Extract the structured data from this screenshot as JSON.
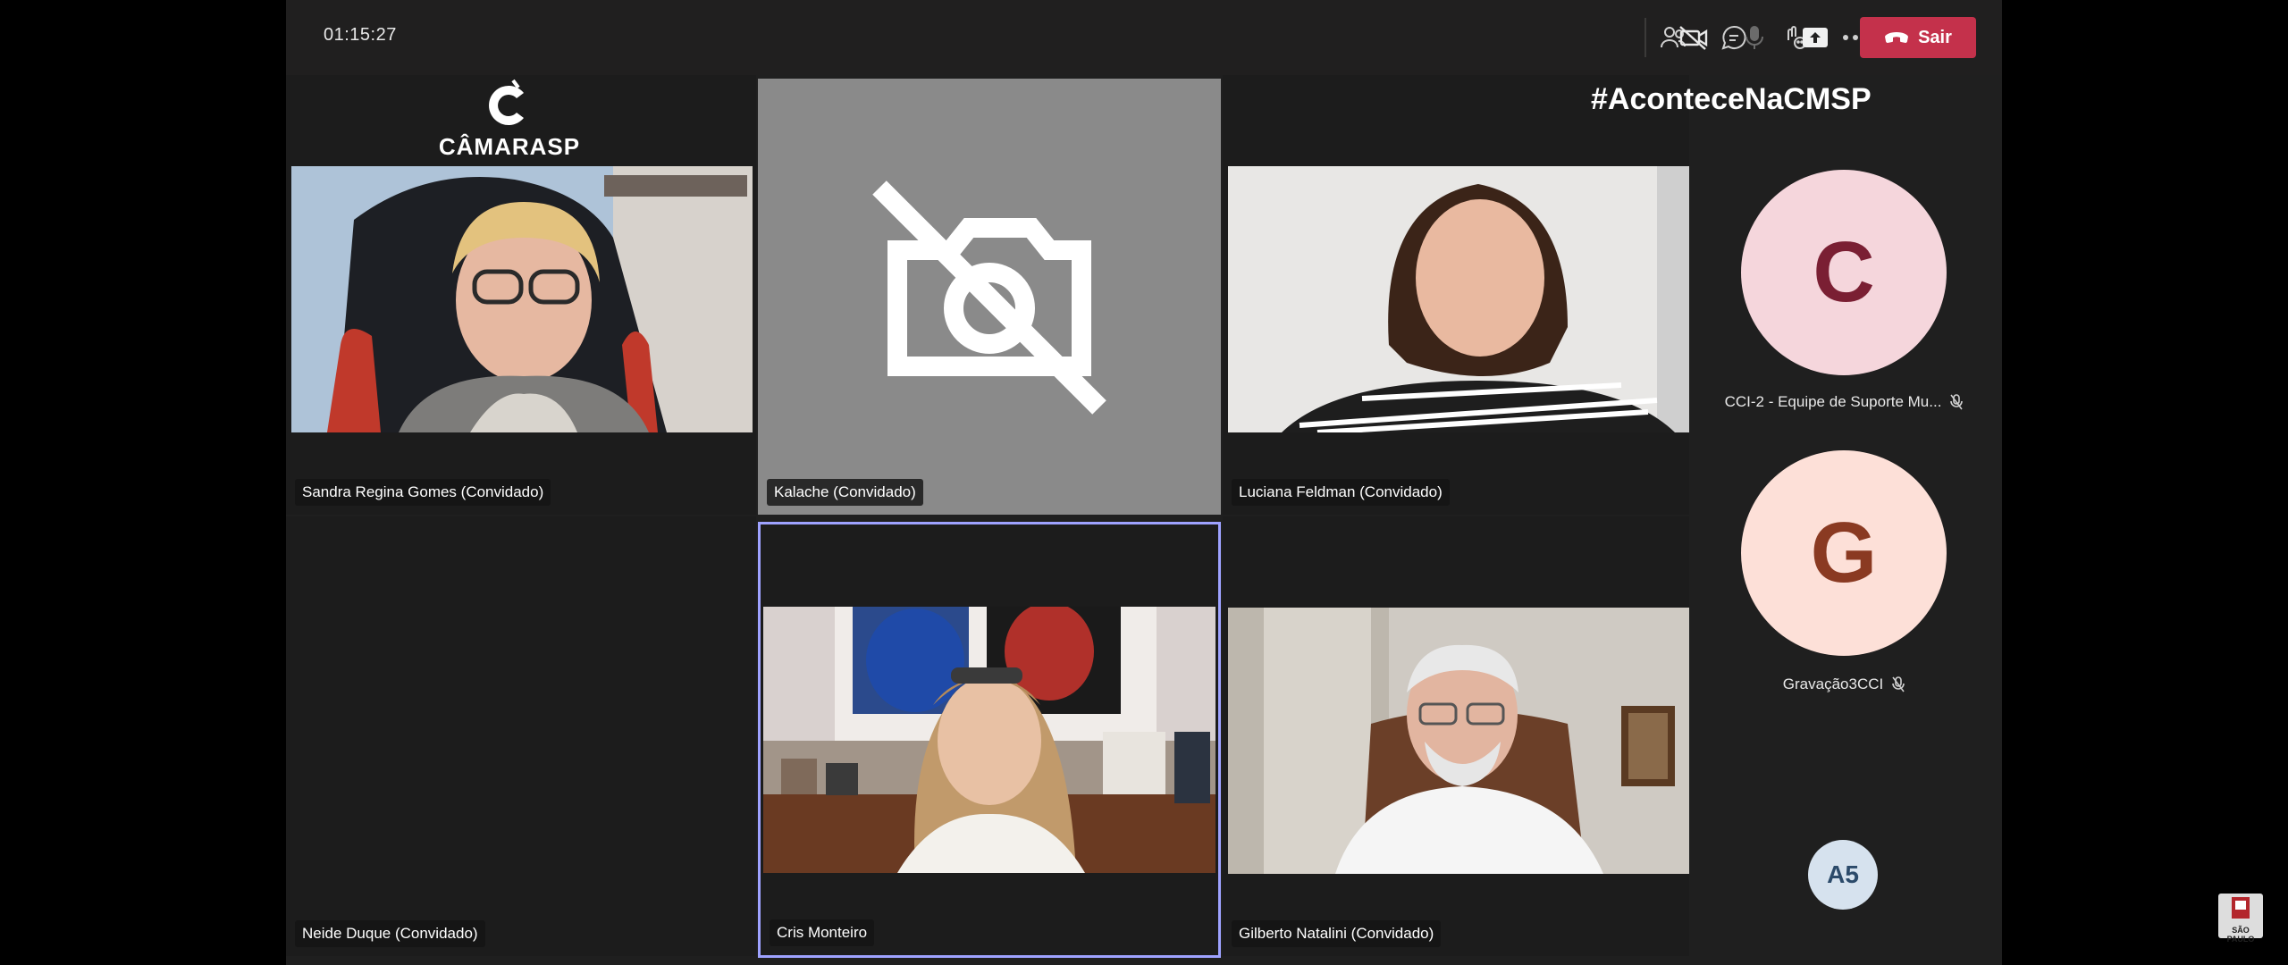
{
  "meeting": {
    "timer": "01:15:27",
    "leave_label": "Sair"
  },
  "toolbar": {
    "icons": [
      "people-icon",
      "chat-icon",
      "reactions-icon",
      "more-icon",
      "camera-off-icon",
      "mic-icon",
      "share-icon",
      "phone-hangup-icon"
    ]
  },
  "branding": {
    "logo_text": "CÂMARASP",
    "hashtag": "#AconteceNaCMSP"
  },
  "participants": [
    {
      "name": "Sandra Regina Gomes (Convidado)"
    },
    {
      "name": "Kalache (Convidado)"
    },
    {
      "name": "Luciana Feldman (Convidado)"
    },
    {
      "name": "Neide Duque (Convidado)"
    },
    {
      "name": "Cris Monteiro"
    },
    {
      "name": "Gilberto Natalini (Convidado)"
    }
  ],
  "sidebar": {
    "items": [
      {
        "initial": "C",
        "name": "CCI-2 - Equipe de Suporte Mu...",
        "color": "#f5d6dc",
        "text_color": "#7a1f33"
      },
      {
        "initial": "G",
        "name": "Gravação3CCI",
        "color": "#fde0d8",
        "text_color": "#8a3a22"
      }
    ],
    "overflow": "A5"
  },
  "colors": {
    "accent": "#9ea2ff",
    "leave": "#c4314b"
  },
  "corner_logo": "SÃO PAULO"
}
